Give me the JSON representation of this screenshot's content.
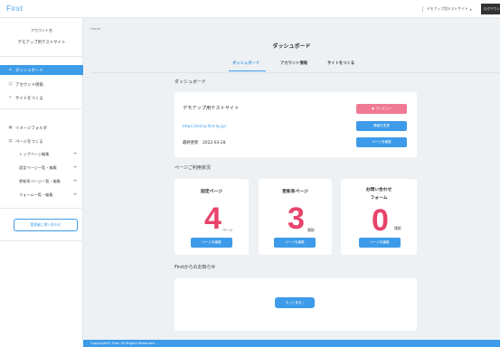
{
  "header": {
    "logo": "First",
    "site_select": "デモアップ用テストサイト",
    "logout": "ログアウト"
  },
  "sidebar": {
    "account_label": "アカウント名",
    "account_name": "デモアップ用テストサイト",
    "nav": [
      {
        "label": "ダッシュボード",
        "icon": "home-icon"
      },
      {
        "label": "アカウント情報",
        "icon": "user-icon"
      },
      {
        "label": "サイトをつくる",
        "icon": "edit-icon"
      },
      {
        "label": "イメージフォルダ",
        "icon": "image-icon"
      },
      {
        "label": "ページをつくる",
        "icon": "page-icon"
      }
    ],
    "sub": [
      {
        "label": "トップページ編集"
      },
      {
        "label": "固定ページ一覧・編集"
      },
      {
        "label": "更新系ページ一覧・編集"
      },
      {
        "label": "フォーム一覧・編集"
      }
    ],
    "contact_button": "管理者に問い合わせ"
  },
  "main": {
    "breadcrumb": "Home",
    "title": "ダッシュボード",
    "tabs": [
      {
        "label": "ダッシュボード"
      },
      {
        "label": "アカウント情報"
      },
      {
        "label": "サイトをつくる"
      }
    ],
    "dashboard": {
      "section_title": "ダッシュボード",
      "site_name": "デモアップ用テストサイト",
      "url": "https://shiina.first-hp.jp/",
      "last_update_label": "最終更新",
      "last_update": "2022-03-28",
      "preview_button": "プレビュー",
      "change_info_button": "情報を変更",
      "edit_page_button": "ページを編集"
    },
    "usage": {
      "section_title": "ページご利用状況",
      "cards": [
        {
          "title": "固定ページ",
          "count": "4",
          "unit": "ページ",
          "button": "ページを編集"
        },
        {
          "title": "更新系ページ",
          "count": "3",
          "unit": "種類",
          "button": "ページを編集"
        },
        {
          "title": "お問い合わせ",
          "title2": "フォーム",
          "count": "0",
          "unit": "種類",
          "button": "ページを編集"
        }
      ]
    },
    "news": {
      "section_title": "Firstからのお知らせ",
      "more_button": "もっと見る"
    }
  },
  "footer": {
    "copyright": "Copyright© First. All Rights Reserved."
  },
  "colors": {
    "accent": "#3d9be9",
    "pink": "#f07a93",
    "number": "#e8436b"
  }
}
